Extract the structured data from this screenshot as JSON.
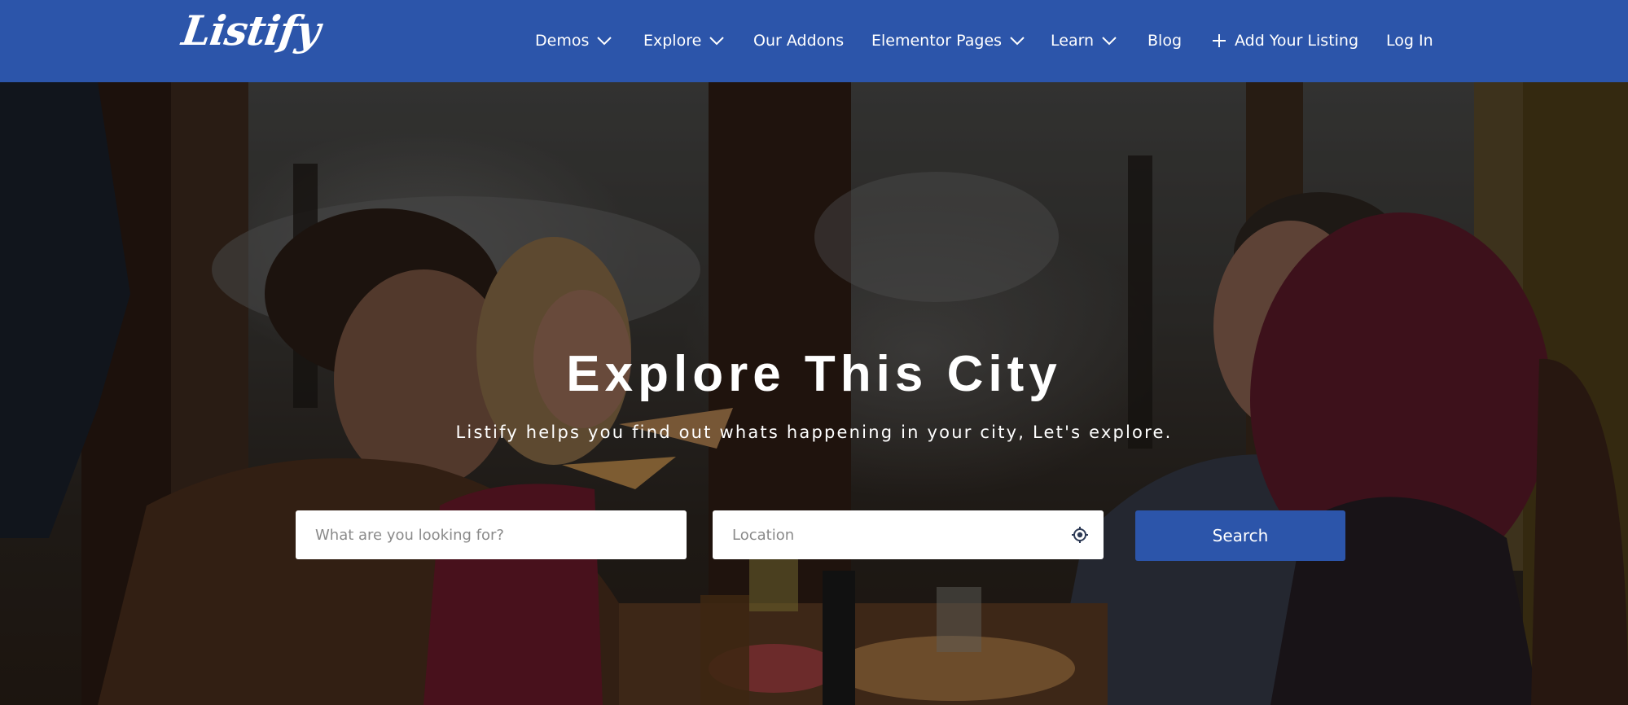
{
  "header": {
    "logo": "Listify",
    "brand_color": "#2c55aa",
    "nav": [
      {
        "label": "Demos",
        "dropdown": true
      },
      {
        "label": "Explore",
        "dropdown": true
      },
      {
        "label": "Our Addons",
        "dropdown": false
      },
      {
        "label": "Elementor Pages",
        "dropdown": true
      },
      {
        "label": "Learn",
        "dropdown": true
      },
      {
        "label": "Blog",
        "dropdown": false
      },
      {
        "label": "Add Your Listing",
        "dropdown": false,
        "icon": "plus-icon"
      },
      {
        "label": "Log In",
        "dropdown": false
      }
    ]
  },
  "hero": {
    "title": "Explore This City",
    "subtitle": "Listify helps you find out whats happening in your city, Let's explore.",
    "search": {
      "keyword_placeholder": "What are you looking for?",
      "keyword_value": "",
      "location_placeholder": "Location",
      "location_value": "",
      "location_icon": "locate-icon",
      "button_label": "Search"
    }
  }
}
